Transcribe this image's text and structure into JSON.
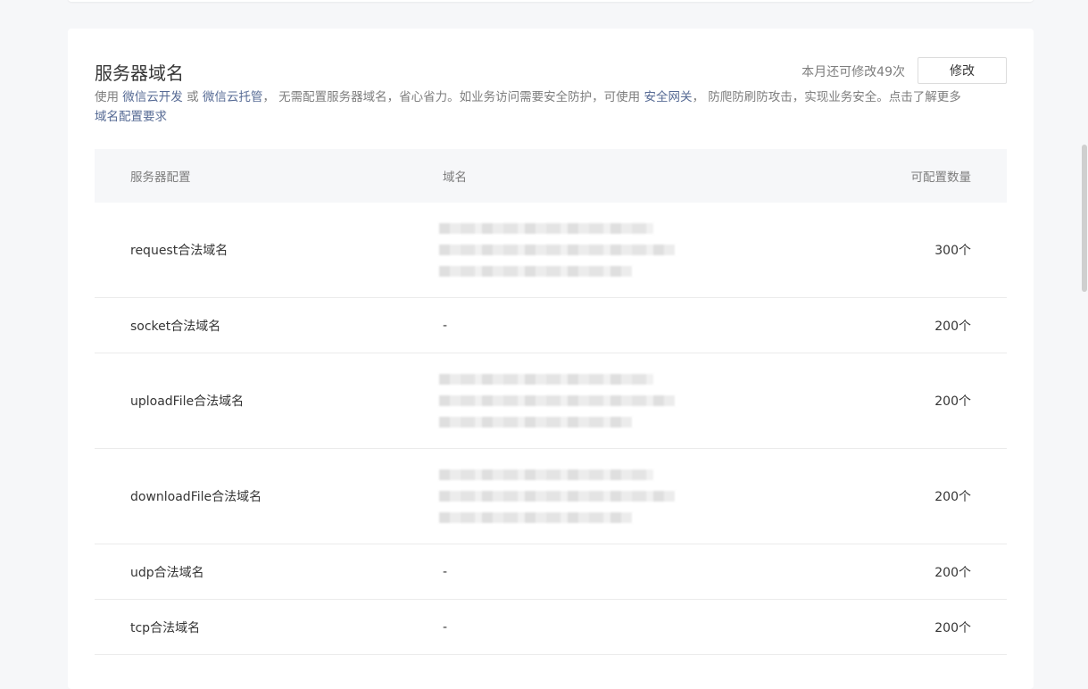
{
  "section": {
    "title": "服务器域名",
    "quota_text": "本月还可修改49次",
    "edit_label": "修改"
  },
  "description": {
    "part1": "使用 ",
    "link_cloud_dev": "微信云开发",
    "part2": " 或 ",
    "link_cloud_hosting": "微信云托管",
    "part3": "， 无需配置服务器域名，省心省力。如业务访问需要安全防护，可使用 ",
    "link_security_gateway": "安全网关",
    "part4": "， 防爬防刷防攻击，实现业务安全。点击了解更多",
    "link_requirements": "域名配置要求"
  },
  "table": {
    "headers": [
      "服务器配置",
      "域名",
      "可配置数量"
    ],
    "rows": [
      {
        "name": "request合法域名",
        "domain": "blurred",
        "count": "300个"
      },
      {
        "name": "socket合法域名",
        "domain": "-",
        "count": "200个"
      },
      {
        "name": "uploadFile合法域名",
        "domain": "blurred",
        "count": "200个"
      },
      {
        "name": "downloadFile合法域名",
        "domain": "blurred",
        "count": "200个"
      },
      {
        "name": "udp合法域名",
        "domain": "-",
        "count": "200个"
      },
      {
        "name": "tcp合法域名",
        "domain": "-",
        "count": "200个"
      }
    ]
  },
  "colors": {
    "link": "#576b95",
    "muted_text": "#7e7e7e",
    "primary_text": "#353535",
    "page_bg": "#f6f7f9"
  }
}
